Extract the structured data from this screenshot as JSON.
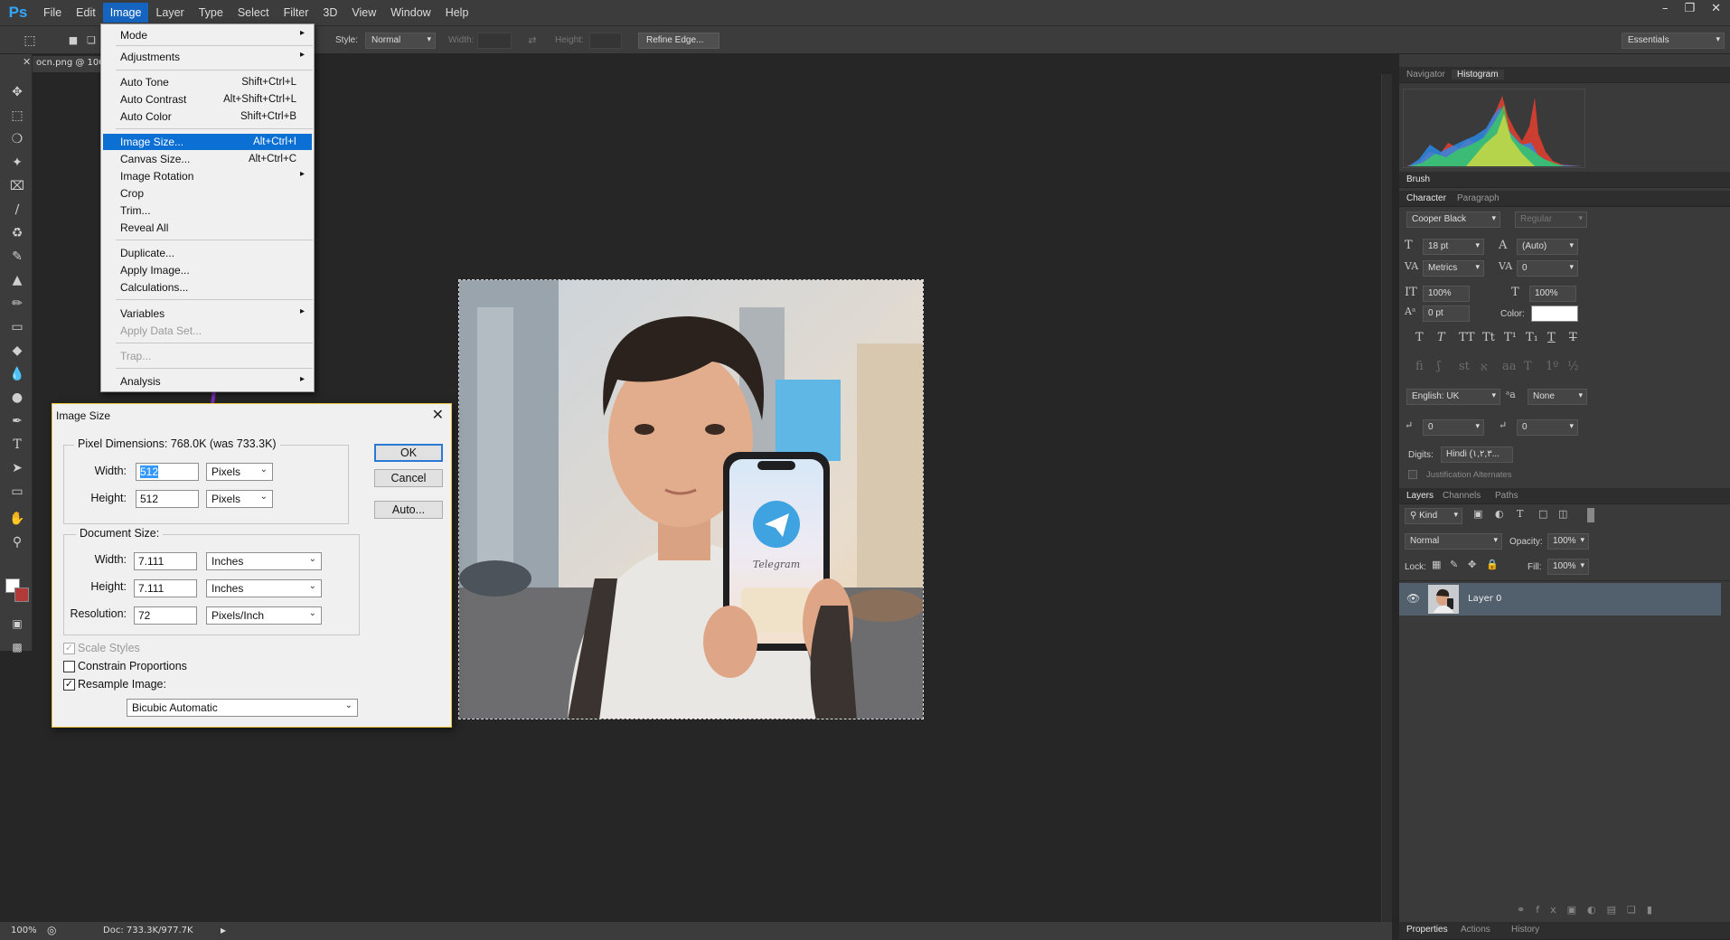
{
  "app": {
    "logo": "Ps"
  },
  "menubar": {
    "items": [
      "File",
      "Edit",
      "Image",
      "Layer",
      "Type",
      "Select",
      "Filter",
      "3D",
      "View",
      "Window",
      "Help"
    ],
    "active": "Image"
  },
  "options": {
    "style_label": "Style:",
    "style_value": "Normal",
    "width_label": "Width:",
    "height_label": "Height:",
    "refine_edge": "Refine Edge...",
    "workspace": "Essentials"
  },
  "document": {
    "tab_title": "ocn.png @ 100",
    "zoom": "100%",
    "doc_info": "Doc: 733.3K/977.7K"
  },
  "image_menu": {
    "mode": "Mode",
    "adjustments": "Adjustments",
    "auto_tone": "Auto Tone",
    "auto_tone_sc": "Shift+Ctrl+L",
    "auto_contrast": "Auto Contrast",
    "auto_contrast_sc": "Alt+Shift+Ctrl+L",
    "auto_color": "Auto Color",
    "auto_color_sc": "Shift+Ctrl+B",
    "image_size": "Image Size...",
    "image_size_sc": "Alt+Ctrl+I",
    "canvas_size": "Canvas Size...",
    "canvas_size_sc": "Alt+Ctrl+C",
    "image_rotation": "Image Rotation",
    "crop": "Crop",
    "trim": "Trim...",
    "reveal_all": "Reveal All",
    "duplicate": "Duplicate...",
    "apply_image": "Apply Image...",
    "calculations": "Calculations...",
    "variables": "Variables",
    "apply_data_set": "Apply Data Set...",
    "trap": "Trap...",
    "analysis": "Analysis"
  },
  "dialog": {
    "title": "Image Size",
    "pixel_dimensions_label": "Pixel Dimensions:",
    "pixel_dimensions_value": "768.0K (was 733.3K)",
    "width_label": "Width:",
    "height_label": "Height:",
    "px_width": "512",
    "px_height": "512",
    "px_unit": "Pixels",
    "document_size_label": "Document Size:",
    "doc_width": "7.111",
    "doc_height": "7.111",
    "doc_unit": "Inches",
    "resolution_label": "Resolution:",
    "resolution": "72",
    "resolution_unit": "Pixels/Inch",
    "ok": "OK",
    "cancel": "Cancel",
    "auto": "Auto...",
    "scale_styles": "Scale Styles",
    "constrain": "Constrain Proportions",
    "resample": "Resample Image:",
    "resample_method": "Bicubic Automatic"
  },
  "panels": {
    "navigator_tab": "Navigator",
    "histogram_tab": "Histogram",
    "brush_tab": "Brush",
    "character_tab": "Character",
    "paragraph_tab": "Paragraph",
    "font_family": "Cooper Black",
    "font_style": "Regular",
    "font_size": "18 pt",
    "leading": "(Auto)",
    "kerning": "Metrics",
    "tracking": "0",
    "vscale": "100%",
    "hscale": "100%",
    "baseline": "0 pt",
    "color_label": "Color:",
    "language": "English: UK",
    "aa": "None",
    "ls1": "0",
    "ls2": "0",
    "digits_label": "Digits:",
    "digits_value": "Hindi (١,٢,٣...",
    "justification": "Justification Alternates",
    "layers_tab": "Layers",
    "channels_tab": "Channels",
    "paths_tab": "Paths",
    "kind": "Kind",
    "blend_mode": "Normal",
    "opacity_label": "Opacity:",
    "opacity": "100%",
    "lock_label": "Lock:",
    "fill_label": "Fill:",
    "fill": "100%",
    "layer_name": "Layer 0",
    "properties_tab": "Properties",
    "actions_tab": "Actions",
    "history_tab": "History"
  },
  "canvas": {
    "phone_app_text": "Telegram"
  },
  "colors": {
    "accent": "#0b6fd4",
    "ps_blue": "#31a8ff",
    "selection_purple": "#7a2fb8"
  }
}
